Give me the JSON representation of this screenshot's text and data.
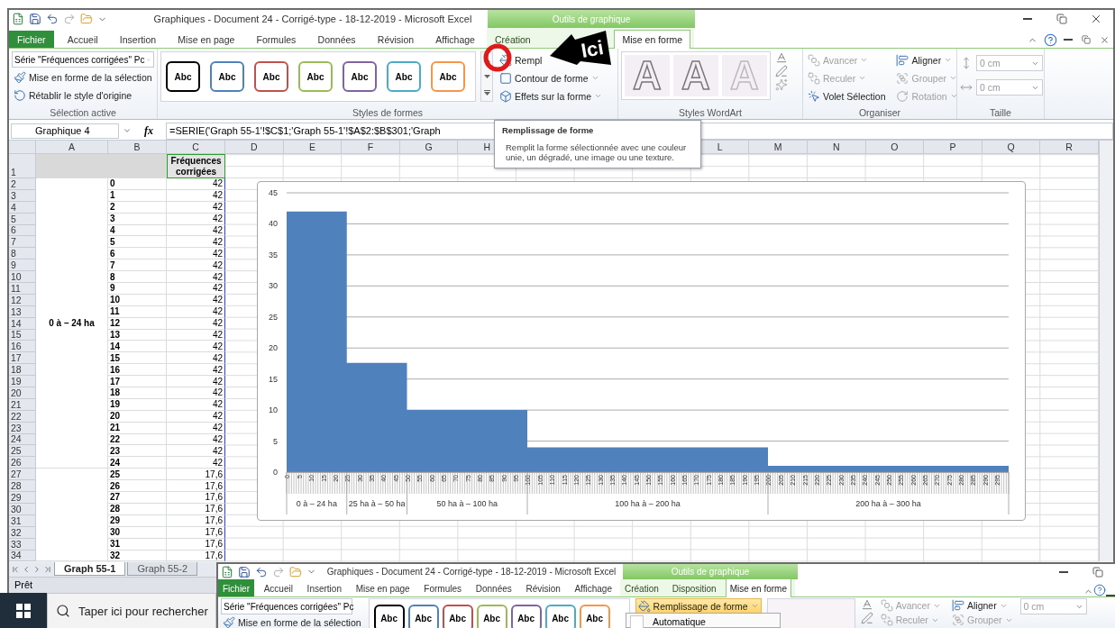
{
  "window": {
    "title": "Graphiques - Document 24 - Corrigé-type - 18-12-2019 - Microsoft Excel",
    "context_group": "Outils de graphique"
  },
  "tabs": [
    {
      "label": "Fichier",
      "kind": "file",
      "selected": false
    },
    {
      "label": "Accueil",
      "kind": "normal",
      "selected": false
    },
    {
      "label": "Insertion",
      "kind": "normal",
      "selected": false
    },
    {
      "label": "Mise en page",
      "kind": "normal",
      "selected": false
    },
    {
      "label": "Formules",
      "kind": "normal",
      "selected": false
    },
    {
      "label": "Données",
      "kind": "normal",
      "selected": false
    },
    {
      "label": "Révision",
      "kind": "normal",
      "selected": false
    },
    {
      "label": "Affichage",
      "kind": "normal",
      "selected": false
    },
    {
      "label": "Création",
      "kind": "context",
      "selected": false
    },
    {
      "label": "Mise en forme",
      "kind": "context",
      "selected": true
    }
  ],
  "ribbon": {
    "selection": {
      "dropdown": "Série \"Fréquences corrigées\" Pc",
      "items": [
        "Mise en forme de la sélection",
        "Rétablir le style d'origine"
      ],
      "label": "Sélection active"
    },
    "shape_styles": {
      "swatches": [
        {
          "text": "Abc",
          "color": "#000000"
        },
        {
          "text": "Abc",
          "color": "#4f81bd"
        },
        {
          "text": "Abc",
          "color": "#c0504d"
        },
        {
          "text": "Abc",
          "color": "#9bbb59"
        },
        {
          "text": "Abc",
          "color": "#8064a2"
        },
        {
          "text": "Abc",
          "color": "#4bacc6"
        },
        {
          "text": "Abc",
          "color": "#f79646"
        }
      ],
      "commands": [
        "Rempl",
        "Contour de forme",
        "Effets sur la forme"
      ],
      "label": "Styles de formes"
    },
    "wordart": {
      "samples": [
        "A",
        "A",
        "A"
      ],
      "label": "Styles WordArt"
    },
    "arrange": {
      "items": [
        {
          "label": "Avancer",
          "disabled": true,
          "dropdown": true
        },
        {
          "label": "Reculer",
          "disabled": true,
          "dropdown": true
        },
        {
          "label": "Volet Sélection",
          "disabled": false,
          "dropdown": false
        },
        {
          "label": "Aligner",
          "disabled": false,
          "dropdown": true
        },
        {
          "label": "Grouper",
          "disabled": true,
          "dropdown": true
        },
        {
          "label": "Rotation",
          "disabled": true,
          "dropdown": true
        }
      ],
      "label": "Organiser"
    },
    "size": {
      "fields": [
        "0 cm",
        "0 cm"
      ],
      "label": "Taille"
    }
  },
  "formula_bar": {
    "name_box": "Graphique 4",
    "fx_label": "fx",
    "formula": "=SERIE('Graph 55-1'!$C$1;'Graph 55-1'!$A$2:$B$301;'Graph"
  },
  "tooltip": {
    "title": "Remplissage de forme",
    "text": "Remplit la forme sélectionnée avec une couleur unie, un dégradé, une image ou une texture."
  },
  "callout": {
    "text": "Ici"
  },
  "sheet": {
    "columns": [
      {
        "label": "A"
      },
      {
        "label": "B"
      },
      {
        "label": "C"
      },
      {
        "label": "D"
      },
      {
        "label": "E"
      },
      {
        "label": "F"
      },
      {
        "label": "G"
      },
      {
        "label": "H"
      },
      {},
      {},
      {},
      {
        "label": "L"
      },
      {
        "label": "M"
      },
      {
        "label": "N"
      },
      {
        "label": "O"
      },
      {
        "label": "P"
      },
      {
        "label": "Q"
      },
      {
        "label": "R"
      }
    ],
    "header_row": {
      "number": "1",
      "c": "Fréquences corrigées"
    },
    "groups": [
      {
        "label": "0 à – 24 ha",
        "rows": [
          {
            "number": "2",
            "b": "0",
            "c": "42"
          },
          {
            "number": "3",
            "b": "1",
            "c": "42"
          },
          {
            "number": "4",
            "b": "2",
            "c": "42"
          },
          {
            "number": "5",
            "b": "3",
            "c": "42"
          },
          {
            "number": "6",
            "b": "4",
            "c": "42"
          },
          {
            "number": "7",
            "b": "5",
            "c": "42"
          },
          {
            "number": "8",
            "b": "6",
            "c": "42"
          },
          {
            "number": "9",
            "b": "7",
            "c": "42"
          },
          {
            "number": "10",
            "b": "8",
            "c": "42"
          },
          {
            "number": "11",
            "b": "9",
            "c": "42"
          },
          {
            "number": "12",
            "b": "10",
            "c": "42"
          },
          {
            "number": "13",
            "b": "11",
            "c": "42"
          },
          {
            "number": "14",
            "b": "12",
            "c": "42"
          },
          {
            "number": "15",
            "b": "13",
            "c": "42"
          },
          {
            "number": "16",
            "b": "14",
            "c": "42"
          },
          {
            "number": "17",
            "b": "15",
            "c": "42"
          },
          {
            "number": "18",
            "b": "16",
            "c": "42"
          },
          {
            "number": "19",
            "b": "17",
            "c": "42"
          },
          {
            "number": "20",
            "b": "18",
            "c": "42"
          },
          {
            "number": "21",
            "b": "19",
            "c": "42"
          },
          {
            "number": "22",
            "b": "20",
            "c": "42"
          },
          {
            "number": "23",
            "b": "21",
            "c": "42"
          },
          {
            "number": "24",
            "b": "22",
            "c": "42"
          },
          {
            "number": "25",
            "b": "23",
            "c": "42"
          },
          {
            "number": "26",
            "b": "24",
            "c": "42"
          }
        ]
      },
      {
        "rows": [
          {
            "number": "27",
            "b": "25",
            "c": "17,6"
          },
          {
            "number": "28",
            "b": "26",
            "c": "17,6"
          },
          {
            "number": "29",
            "b": "27",
            "c": "17,6"
          },
          {
            "number": "30",
            "b": "28",
            "c": "17,6"
          },
          {
            "number": "31",
            "b": "29",
            "c": "17,6"
          },
          {
            "number": "32",
            "b": "30",
            "c": "17,6"
          },
          {
            "number": "33",
            "b": "31",
            "c": "17,6"
          },
          {
            "number": "34",
            "b": "32",
            "c": "17,6"
          }
        ]
      }
    ]
  },
  "chart": {
    "chart_data": {
      "type": "area",
      "x": [
        0,
        25,
        25,
        50,
        50,
        100,
        100,
        200,
        200,
        300
      ],
      "series": [
        {
          "color": "#4f81bd",
          "values": [
            42,
            42,
            17.6,
            17.6,
            10,
            10,
            4,
            4,
            1,
            1
          ]
        }
      ],
      "xlim": [
        0,
        300
      ],
      "ylim": [
        0,
        45
      ],
      "yticks": [
        0,
        5,
        10,
        15,
        20,
        25,
        30,
        35,
        40,
        45
      ],
      "xticks": [
        0,
        5,
        10,
        15,
        20,
        25,
        30,
        35,
        40,
        45,
        50,
        55,
        60,
        65,
        70,
        75,
        80,
        85,
        90,
        95,
        100,
        105,
        110,
        115,
        120,
        125,
        130,
        135,
        140,
        145,
        150,
        155,
        160,
        165,
        170,
        175,
        180,
        185,
        190,
        195,
        200,
        205,
        210,
        215,
        220,
        225,
        230,
        235,
        240,
        245,
        250,
        255,
        260,
        265,
        270,
        275,
        280,
        285,
        290,
        295
      ],
      "grid": true,
      "annotations": [
        "0 à – 24 ha",
        "25 ha à – 50 ha",
        "50 ha à – 100 ha",
        "100 ha à – 200 ha",
        "200 ha à – 300 ha"
      ]
    }
  },
  "sheet_tabs": [
    {
      "label": "Graph 55-1",
      "selected": true
    },
    {
      "label": "Graph 55-2",
      "selected": false
    }
  ],
  "status_bar": {
    "text": "Prêt"
  },
  "taskbar": {
    "search_placeholder": "Taper ici pour rechercher"
  },
  "second_window": {
    "title": "Graphiques - Document 24 - Corrigé-type - 18-12-2019 - Microsoft Excel",
    "context_group": "Outils de graphique",
    "tabs": [
      {
        "label": "Fichier",
        "kind": "file",
        "selected": false
      },
      {
        "label": "Accueil",
        "kind": "normal",
        "selected": false
      },
      {
        "label": "Insertion",
        "kind": "normal",
        "selected": false
      },
      {
        "label": "Mise en page",
        "kind": "normal",
        "selected": false
      },
      {
        "label": "Formules",
        "kind": "normal",
        "selected": false
      },
      {
        "label": "Données",
        "kind": "normal",
        "selected": false
      },
      {
        "label": "Révision",
        "kind": "normal",
        "selected": false
      },
      {
        "label": "Affichage",
        "kind": "normal",
        "selected": false
      },
      {
        "label": "Création",
        "kind": "context",
        "selected": false
      },
      {
        "label": "Disposition",
        "kind": "context",
        "selected": false
      },
      {
        "label": "Mise en forme",
        "kind": "context",
        "selected": true
      }
    ],
    "selection_dropdown": "Série \"Fréquences corrigées\" Pc",
    "selection_item": "Mise en forme de la sélection",
    "swatches": [
      {
        "text": "Abc",
        "color": "#000000"
      },
      {
        "text": "Abc",
        "color": "#4f81bd"
      },
      {
        "text": "Abc",
        "color": "#c0504d"
      },
      {
        "text": "Abc",
        "color": "#9bbb59"
      },
      {
        "text": "Abc",
        "color": "#8064a2"
      },
      {
        "text": "Abc",
        "color": "#4bacc6"
      },
      {
        "text": "Abc",
        "color": "#f79646"
      }
    ],
    "fill_button": {
      "label": "Remplissage de forme",
      "active": true
    },
    "menu_items": [
      "Automatique"
    ],
    "arrange": [
      {
        "label": "Avancer",
        "disabled": true
      },
      {
        "label": "Reculer",
        "disabled": true
      },
      {
        "label": "Aligner",
        "disabled": false
      },
      {
        "label": "Grouper",
        "disabled": true
      }
    ],
    "size_field": "0 cm"
  }
}
